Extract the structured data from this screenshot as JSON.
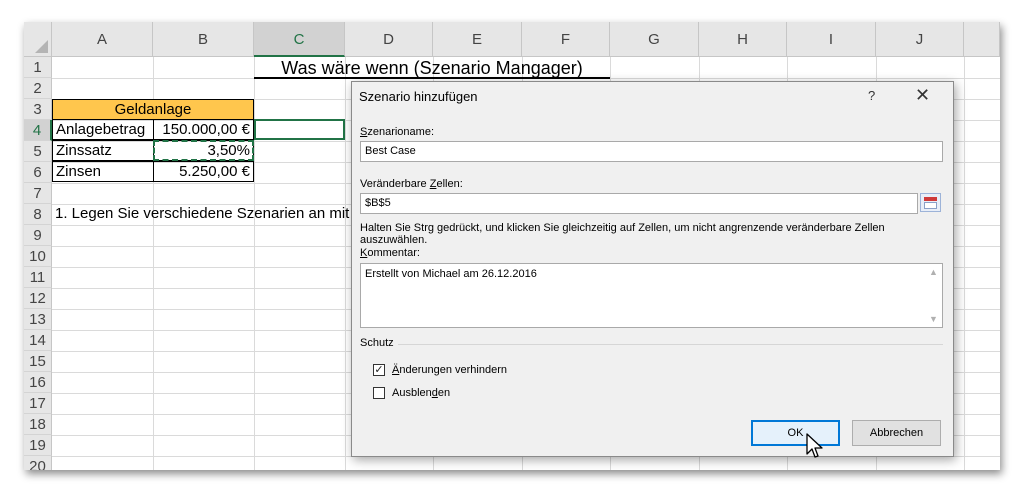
{
  "sheet": {
    "columns": [
      "A",
      "B",
      "C",
      "D",
      "E",
      "F",
      "G",
      "H",
      "I",
      "J"
    ],
    "selected_column": "C",
    "rows": [
      "1",
      "2",
      "3",
      "4",
      "5",
      "6",
      "7",
      "8",
      "9",
      "10",
      "11",
      "12",
      "13",
      "14",
      "15",
      "16",
      "17",
      "18",
      "19",
      "20"
    ],
    "selected_row": "4",
    "title": "Was wäre wenn (Szenario Mangager)",
    "table_header": "Geldanlage",
    "table": [
      {
        "label": "Anlagebetrag",
        "value": "150.000,00 €"
      },
      {
        "label": "Zinssatz",
        "value": "3,50%"
      },
      {
        "label": "Zinsen",
        "value": "5.250,00 €"
      }
    ],
    "row8_text": "1. Legen Sie verschiedene Szenarien an mit a"
  },
  "dialog": {
    "title": "Szenario hinzufügen",
    "help": "?",
    "close": "✕",
    "name_label_u": "S",
    "name_label_rest": "zenarioname:",
    "name_value": "Best Case",
    "cells_label_pre": "Veränderbare ",
    "cells_label_u": "Z",
    "cells_label_post": "ellen:",
    "cells_value": "$B$5",
    "hint": "Halten Sie Strg gedrückt, und klicken Sie gleichzeitig auf Zellen, um nicht angrenzende veränderbare Zellen auszuwählen.",
    "comment_label_u": "K",
    "comment_label_rest": "ommentar:",
    "comment_value": "Erstellt von Michael am 26.12.2016",
    "protection_label": "Schutz",
    "prevent_changes_u": "Ä",
    "prevent_changes_rest": "nderungen verhindern",
    "prevent_changes_checked": true,
    "hide_pre": "Ausblen",
    "hide_u": "d",
    "hide_post": "en",
    "hide_checked": false,
    "ok_label": "OK",
    "cancel_label": "Abbrechen"
  },
  "colors": {
    "excel_green": "#217346",
    "header_fill": "#ffc64d",
    "focus_blue": "#0078d7"
  }
}
